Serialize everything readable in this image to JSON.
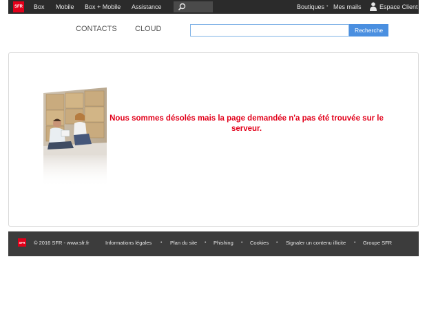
{
  "topbar": {
    "logo_text": "SFR",
    "nav": [
      "Box",
      "Mobile",
      "Box + Mobile",
      "Assistance"
    ],
    "right_links": [
      "Boutiques",
      "Mes mails",
      "Espace Client"
    ],
    "separator": "•"
  },
  "subnav": {
    "items": [
      "CONTACTS",
      "CLOUD"
    ],
    "search_placeholder": "",
    "search_button": "Recherche"
  },
  "main": {
    "error_message": "Nous sommes désolés mais la page demandée n'a pas été trouvée sur le serveur."
  },
  "footer": {
    "logo_text": "SFR",
    "copyright": "© 2016 SFR - www.sfr.fr",
    "links": [
      "Informations légales",
      "Plan du site",
      "Phishing",
      "Cookies",
      "Signaler un contenu illicite",
      "Groupe SFR"
    ],
    "separator": "•"
  },
  "colors": {
    "brand_red": "#e2001a",
    "topbar_bg": "#2b2b2b",
    "footer_bg": "#3c3c3c",
    "button_blue": "#4a8fe0"
  }
}
